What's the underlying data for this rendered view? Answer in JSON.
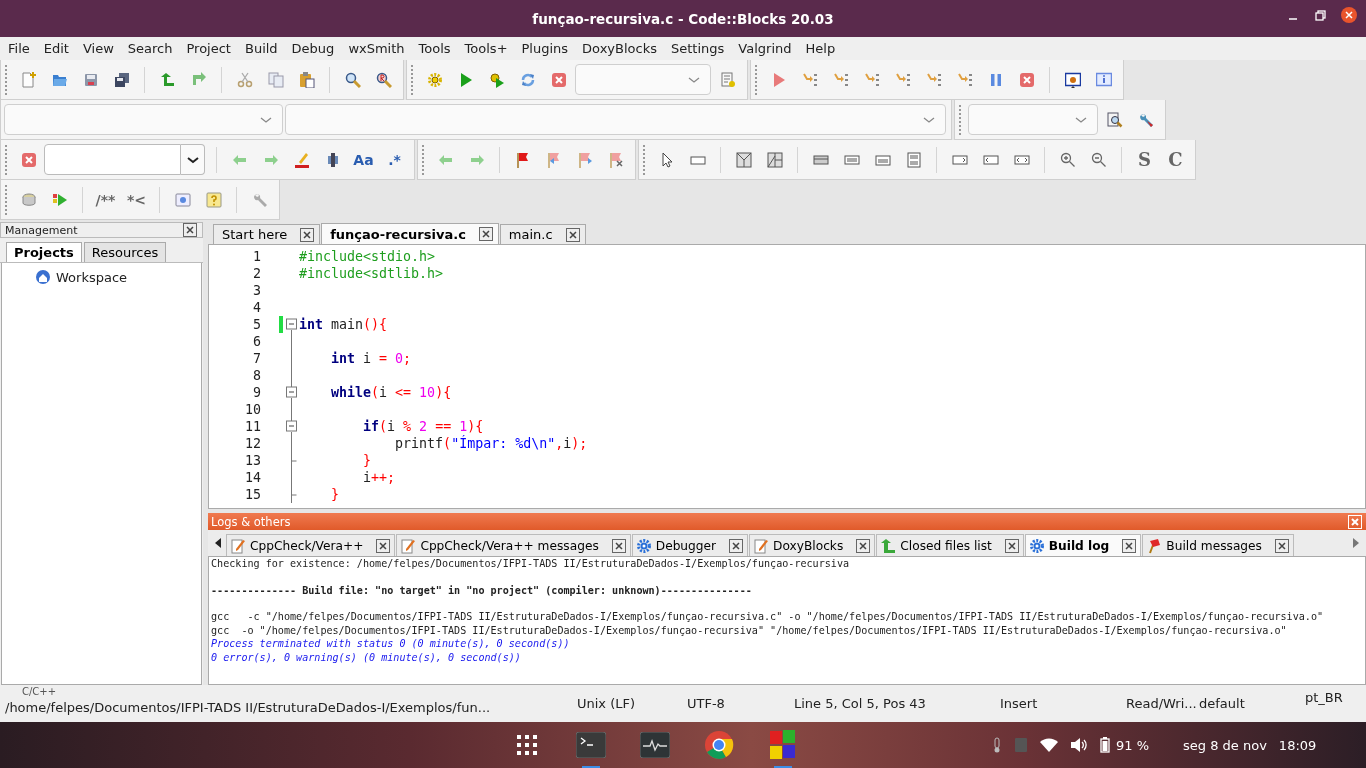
{
  "window": {
    "title": "funçao-recursiva.c - Code::Blocks 20.03"
  },
  "menu": [
    "File",
    "Edit",
    "View",
    "Search",
    "Project",
    "Build",
    "Debug",
    "wxSmith",
    "Tools",
    "Tools+",
    "Plugins",
    "DoxyBlocks",
    "Settings",
    "Valgrind",
    "Help"
  ],
  "toolbar_glyphs": [
    "Aa",
    ".*",
    "S",
    "C",
    "/**",
    "*<"
  ],
  "management": {
    "title": "Management",
    "tabs": [
      {
        "label": "Projects",
        "selected": true
      },
      {
        "label": "Resources",
        "selected": false
      }
    ],
    "tree": [
      {
        "label": "Workspace"
      }
    ]
  },
  "editor": {
    "tabs": [
      {
        "label": "Start here",
        "selected": false
      },
      {
        "label": "funçao-recursiva.c",
        "selected": true
      },
      {
        "label": "main.c",
        "selected": false
      }
    ],
    "lines": [
      {
        "number": "1",
        "modified": false,
        "kind": "plain",
        "tokens": [
          {
            "text": "#include<stdio.h>",
            "kind": "pre"
          }
        ]
      },
      {
        "number": "2",
        "modified": false,
        "kind": "plain",
        "tokens": [
          {
            "text": "#include<sdtlib.h>",
            "kind": "pre"
          }
        ]
      },
      {
        "number": "3",
        "modified": false,
        "kind": "plain"
      },
      {
        "number": "4",
        "modified": false,
        "kind": "plain"
      },
      {
        "number": "5",
        "modified": true,
        "kind": "fold_start",
        "tokens": [
          {
            "text": "int",
            "kind": "kw"
          },
          {
            "text": " main",
            "kind": "plain"
          },
          {
            "text": "(){",
            "kind": "op"
          }
        ]
      },
      {
        "number": "6",
        "modified": false,
        "kind": "fold_body"
      },
      {
        "number": "7",
        "modified": false,
        "kind": "fold_body",
        "tokens": [
          {
            "text": "    int",
            "kind": "kw"
          },
          {
            "text": " i ",
            "kind": "plain"
          },
          {
            "text": "=",
            "kind": "op"
          },
          {
            "text": " 0",
            "kind": "num"
          },
          {
            "text": ";",
            "kind": "op"
          }
        ]
      },
      {
        "number": "8",
        "modified": false,
        "kind": "fold_body"
      },
      {
        "number": "9",
        "modified": false,
        "kind": "fold_start",
        "tokens": [
          {
            "text": "    while",
            "kind": "kw"
          },
          {
            "text": "(",
            "kind": "op"
          },
          {
            "text": "i ",
            "kind": "plain"
          },
          {
            "text": "<=",
            "kind": "op"
          },
          {
            "text": " 10",
            "kind": "num"
          },
          {
            "text": "){",
            "kind": "op"
          }
        ]
      },
      {
        "number": "10",
        "modified": false,
        "kind": "fold_body"
      },
      {
        "number": "11",
        "modified": false,
        "kind": "fold_start",
        "tokens": [
          {
            "text": "        if",
            "kind": "kw"
          },
          {
            "text": "(",
            "kind": "op"
          },
          {
            "text": "i ",
            "kind": "plain"
          },
          {
            "text": "%",
            "kind": "op"
          },
          {
            "text": " 2",
            "kind": "num"
          },
          {
            "text": " ==",
            "kind": "op"
          },
          {
            "text": " 1",
            "kind": "num"
          },
          {
            "text": "){",
            "kind": "op"
          }
        ]
      },
      {
        "number": "12",
        "modified": false,
        "kind": "fold_body",
        "tokens": [
          {
            "text": "            printf",
            "kind": "plain"
          },
          {
            "text": "(",
            "kind": "op"
          },
          {
            "text": "\"Ímpar: %d\\n\"",
            "kind": "str"
          },
          {
            "text": ",",
            "kind": "op"
          },
          {
            "text": "i",
            "kind": "plain"
          },
          {
            "text": ");",
            "kind": "op"
          }
        ]
      },
      {
        "number": "13",
        "modified": false,
        "kind": "fold_end",
        "tokens": [
          {
            "text": "        }",
            "kind": "op"
          }
        ]
      },
      {
        "number": "14",
        "modified": false,
        "kind": "fold_body",
        "tokens": [
          {
            "text": "        i",
            "kind": "plain"
          },
          {
            "text": "++;",
            "kind": "op"
          }
        ]
      },
      {
        "number": "15",
        "modified": false,
        "kind": "fold_end",
        "tokens": [
          {
            "text": "    }",
            "kind": "op"
          }
        ]
      }
    ]
  },
  "logs": {
    "title": "Logs & others",
    "tabs": [
      {
        "label": "CppCheck/Vera++",
        "selected": false
      },
      {
        "label": "CppCheck/Vera++ messages",
        "selected": false
      },
      {
        "label": "Debugger",
        "selected": false
      },
      {
        "label": "DoxyBlocks",
        "selected": false
      },
      {
        "label": "Closed files list",
        "selected": false
      },
      {
        "label": "Build log",
        "selected": true
      },
      {
        "label": "Build messages",
        "selected": false
      }
    ],
    "lines": [
      {
        "text": "Checking for existence: /home/felpes/Documentos/IFPI-TADS II/EstruturaDeDados-I/Exemplos/funçao-recursiva",
        "kind": "text"
      },
      {
        "text": "-------------- Build file: \"no target\" in \"no project\" (compiler: unknown)---------------",
        "kind": "header"
      },
      {
        "text": "gcc   -c \"/home/felpes/Documentos/IFPI-TADS II/EstruturaDeDados-I/Exemplos/funçao-recursiva.c\" -o \"/home/felpes/Documentos/IFPI-TADS II/EstruturaDeDados-I/Exemplos/funçao-recursiva.o\"",
        "kind": "text"
      },
      {
        "text": "gcc  -o \"/home/felpes/Documentos/IFPI-TADS II/EstruturaDeDados-I/Exemplos/funçao-recursiva\" \"/home/felpes/Documentos/IFPI-TADS II/EstruturaDeDados-I/Exemplos/funçao-recursiva.o\"",
        "kind": "text"
      },
      {
        "text": "Process terminated with status 0 (0 minute(s), 0 second(s))",
        "kind": "info"
      },
      {
        "text": "0 error(s), 0 warning(s) (0 minute(s), 0 second(s))",
        "kind": "info"
      }
    ]
  },
  "status_bar": {
    "path": "/home/felpes/Documentos/IFPI-TADS II/EstruturaDeDados-I/Exemplos/fun...",
    "overlay": "C/C++",
    "eol": "Unix (LF)",
    "encoding": "UTF-8",
    "position": "Line 5, Col 5, Pos 43",
    "mode": "Insert",
    "access": "Read/Wri...",
    "theme": "default",
    "language": "pt_BR"
  },
  "dock": [
    {
      "running": false
    },
    {
      "running": true
    },
    {
      "running": false
    },
    {
      "running": false
    },
    {
      "running": true
    }
  ],
  "tray": {
    "battery": "91 %",
    "date": "seg 8 de nov",
    "time": "18:09"
  }
}
